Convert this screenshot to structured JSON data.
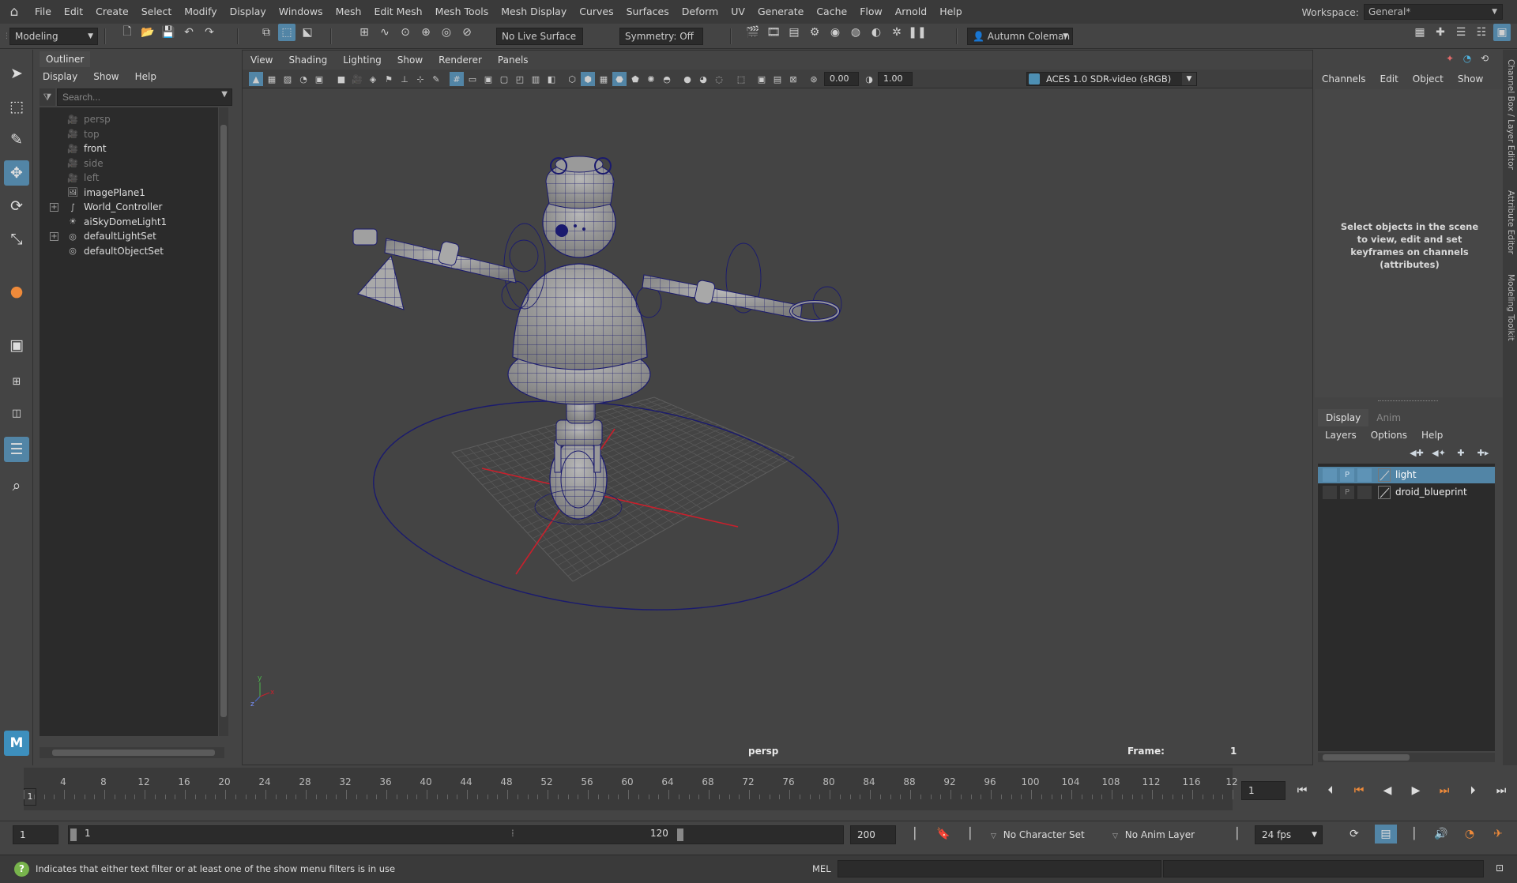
{
  "menubar": {
    "items": [
      "File",
      "Edit",
      "Create",
      "Select",
      "Modify",
      "Display",
      "Windows",
      "Mesh",
      "Edit Mesh",
      "Mesh Tools",
      "Mesh Display",
      "Curves",
      "Surfaces",
      "Deform",
      "UV",
      "Generate",
      "Cache",
      "Flow",
      "Arnold",
      "Help"
    ],
    "workspace_label": "Workspace:",
    "workspace_value": "General*"
  },
  "statusline": {
    "menuset": "Modeling",
    "live_surface": "No Live Surface",
    "symmetry": "Symmetry: Off",
    "user": "Autumn Coleman"
  },
  "outliner": {
    "tab": "Outliner",
    "menu": [
      "Display",
      "Show",
      "Help"
    ],
    "search_placeholder": "Search...",
    "items": [
      {
        "label": "persp",
        "icon": "camera-icon",
        "dim": true,
        "expandable": false
      },
      {
        "label": "top",
        "icon": "camera-icon",
        "dim": true,
        "expandable": false
      },
      {
        "label": "front",
        "icon": "camera-icon",
        "dim": false,
        "expandable": false
      },
      {
        "label": "side",
        "icon": "camera-icon",
        "dim": true,
        "expandable": false
      },
      {
        "label": "left",
        "icon": "camera-icon",
        "dim": true,
        "expandable": false
      },
      {
        "label": "imagePlane1",
        "icon": "image-plane-icon",
        "dim": false,
        "expandable": false
      },
      {
        "label": "World_Controller",
        "icon": "curve-icon",
        "dim": false,
        "expandable": true
      },
      {
        "label": "aiSkyDomeLight1",
        "icon": "light-icon",
        "dim": false,
        "expandable": false
      },
      {
        "label": "defaultLightSet",
        "icon": "set-icon",
        "dim": false,
        "expandable": true
      },
      {
        "label": "defaultObjectSet",
        "icon": "set-icon",
        "dim": false,
        "expandable": false
      }
    ]
  },
  "viewport": {
    "menu": [
      "View",
      "Shading",
      "Lighting",
      "Show",
      "Renderer",
      "Panels"
    ],
    "exposure": "0.00",
    "gamma": "1.00",
    "color_space": "ACES 1.0 SDR-video (sRGB)",
    "camera": "persp",
    "frame_label": "Frame:",
    "frame_value": "1"
  },
  "channelbox": {
    "menu": [
      "Channels",
      "Edit",
      "Object",
      "Show"
    ],
    "message": "Select objects in the scene to view, edit and set keyframes on channels (attributes)"
  },
  "layer_editor": {
    "tabs": [
      "Display",
      "Anim"
    ],
    "menu": [
      "Layers",
      "Options",
      "Help"
    ],
    "layers": [
      {
        "name": "light",
        "selected": true,
        "v": "",
        "p": "P"
      },
      {
        "name": "droid_blueprint",
        "selected": false,
        "v": "",
        "p": "P"
      }
    ]
  },
  "side_tabs": [
    "Channel Box / Layer Editor",
    "Attribute Editor",
    "Modeling Toolkit"
  ],
  "timeline": {
    "ticks": [
      "4",
      "8",
      "12",
      "16",
      "20",
      "24",
      "28",
      "32",
      "36",
      "40",
      "44",
      "48",
      "52",
      "56",
      "60",
      "64",
      "68",
      "72",
      "76",
      "80",
      "84",
      "88",
      "92",
      "96",
      "100",
      "104",
      "108",
      "112",
      "116",
      "12"
    ],
    "current": "1",
    "current_field": "1"
  },
  "range": {
    "start": "1",
    "inner_start": "1",
    "inner_end": "120",
    "end": "200",
    "character_set": "No Character Set",
    "anim_layer": "No Anim Layer",
    "fps": "24 fps"
  },
  "helpline": {
    "icon": "?",
    "text": "Indicates that either text filter or at least one of the show menu filters is in use",
    "mel_label": "MEL"
  },
  "colors": {
    "accent": "#5285a6",
    "wireframe": "#1a1a6e",
    "axis_red": "#c8202c",
    "help_green": "#78b44c"
  }
}
